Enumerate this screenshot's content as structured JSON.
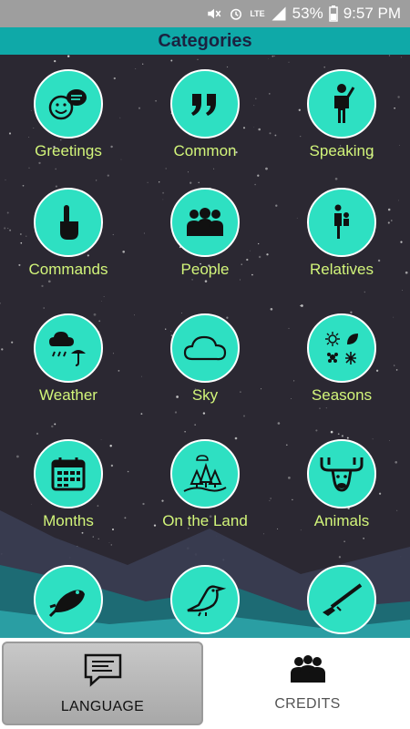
{
  "status_bar": {
    "network": "LTE",
    "battery": "53%",
    "time": "9:57 PM"
  },
  "header": {
    "title": "Categories"
  },
  "categories": [
    {
      "label": "Greetings",
      "icon": "faces-speech-icon"
    },
    {
      "label": "Common",
      "icon": "quote-marks-icon"
    },
    {
      "label": "Speaking",
      "icon": "person-speaking-icon"
    },
    {
      "label": "Commands",
      "icon": "pointing-hand-icon"
    },
    {
      "label": "People",
      "icon": "group-people-icon"
    },
    {
      "label": "Relatives",
      "icon": "adult-child-icon"
    },
    {
      "label": "Weather",
      "icon": "rain-cloud-umbrella-icon"
    },
    {
      "label": "Sky",
      "icon": "cloud-icon"
    },
    {
      "label": "Seasons",
      "icon": "sun-leaf-flower-snowflake-icon"
    },
    {
      "label": "Months",
      "icon": "calendar-icon"
    },
    {
      "label": "On the Land",
      "icon": "trees-landscape-icon"
    },
    {
      "label": "Animals",
      "icon": "moose-icon"
    },
    {
      "label": "",
      "icon": "fish-icon"
    },
    {
      "label": "",
      "icon": "bird-icon"
    },
    {
      "label": "",
      "icon": "rifle-icon"
    }
  ],
  "bottom_nav": {
    "language_label": "LANGUAGE",
    "credits_label": "CREDITS"
  },
  "colors": {
    "accent": "#0fa9a8",
    "circle": "#2ee0c2",
    "label": "#d2f57a",
    "background": "#2b2832"
  }
}
